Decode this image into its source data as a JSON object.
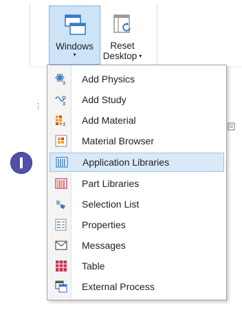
{
  "ribbon": {
    "windows_label": "Windows",
    "reset_label_line1": "Reset",
    "reset_label_line2": "Desktop",
    "caret": "▾"
  },
  "step_marker": {
    "icon": "step-marker-i"
  },
  "menu": {
    "items": [
      {
        "label": "Add Physics",
        "icon": "add-physics-icon"
      },
      {
        "label": "Add Study",
        "icon": "add-study-icon"
      },
      {
        "label": "Add Material",
        "icon": "add-material-icon"
      },
      {
        "label": "Material Browser",
        "icon": "material-browser-icon"
      },
      {
        "label": "Application Libraries",
        "icon": "application-libraries-icon",
        "highlighted": true
      },
      {
        "label": "Part Libraries",
        "icon": "part-libraries-icon"
      },
      {
        "label": "Selection List",
        "icon": "selection-list-icon"
      },
      {
        "label": "Properties",
        "icon": "properties-icon"
      },
      {
        "label": "Messages",
        "icon": "messages-icon"
      },
      {
        "label": "Table",
        "icon": "table-icon"
      },
      {
        "label": "External Process",
        "icon": "external-process-icon"
      }
    ]
  },
  "colors": {
    "highlight": "#d9e9f7",
    "highlight_border": "#99c5ec",
    "badge": "#5150a8",
    "icon_blue": "#3a7bc8",
    "icon_red": "#c8364f",
    "icon_orange": "#f5a31a"
  }
}
